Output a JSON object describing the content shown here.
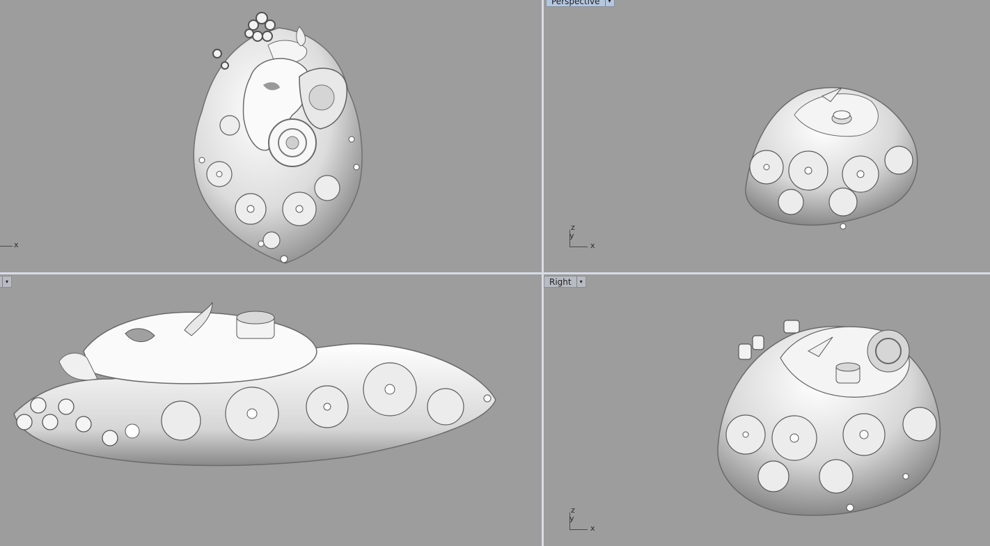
{
  "viewports": {
    "top": {
      "axis_x": "x"
    },
    "perspective": {
      "label": "Perspective",
      "axis_x": "x",
      "axis_y": "y",
      "axis_z": "z"
    },
    "front": {
      "label": ""
    },
    "right": {
      "label": "Right",
      "axis_x": "x",
      "axis_y": "y",
      "axis_z": "z"
    }
  },
  "icons": {
    "dropdown": "triangle-down-icon"
  },
  "colors": {
    "viewport_bg": "#9d9d9d",
    "separator": "#d8dde6",
    "active_tab": "#b4c6e0",
    "model": "#e6e6e6"
  }
}
